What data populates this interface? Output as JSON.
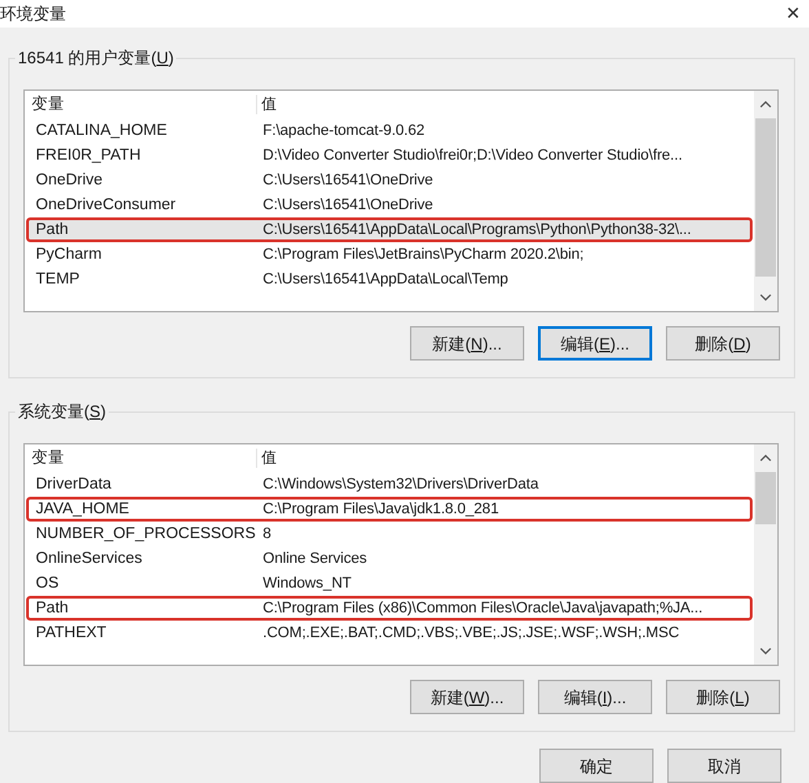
{
  "window": {
    "title": "环境变量",
    "close": "✕"
  },
  "groups": [
    {
      "label": "16541 的用户变量(",
      "accel": "U",
      "label_end": ")",
      "columns": [
        "变量",
        "值"
      ],
      "rows": [
        {
          "name": "CATALINA_HOME",
          "value": "F:\\apache-tomcat-9.0.62",
          "selected": false,
          "highlighted": false
        },
        {
          "name": "FREI0R_PATH",
          "value": "D:\\Video Converter Studio\\frei0r;D:\\Video Converter Studio\\fre...",
          "selected": false,
          "highlighted": false
        },
        {
          "name": "OneDrive",
          "value": "C:\\Users\\16541\\OneDrive",
          "selected": false,
          "highlighted": false
        },
        {
          "name": "OneDriveConsumer",
          "value": "C:\\Users\\16541\\OneDrive",
          "selected": false,
          "highlighted": false
        },
        {
          "name": "Path",
          "value": "C:\\Users\\16541\\AppData\\Local\\Programs\\Python\\Python38-32\\...",
          "selected": true,
          "highlighted": true
        },
        {
          "name": "PyCharm",
          "value": "C:\\Program Files\\JetBrains\\PyCharm 2020.2\\bin;",
          "selected": false,
          "highlighted": false
        },
        {
          "name": "TEMP",
          "value": "C:\\Users\\16541\\AppData\\Local\\Temp",
          "selected": false,
          "highlighted": false
        }
      ],
      "buttons": [
        {
          "label": "新建(",
          "accel": "N",
          "tail": ")...",
          "default": false
        },
        {
          "label": "编辑(",
          "accel": "E",
          "tail": ")...",
          "default": true
        },
        {
          "label": "删除(",
          "accel": "D",
          "tail": ")",
          "default": false
        }
      ]
    },
    {
      "label": "系统变量(",
      "accel": "S",
      "label_end": ")",
      "columns": [
        "变量",
        "值"
      ],
      "rows": [
        {
          "name": "DriverData",
          "value": "C:\\Windows\\System32\\Drivers\\DriverData",
          "selected": false,
          "highlighted": false
        },
        {
          "name": "JAVA_HOME",
          "value": "C:\\Program Files\\Java\\jdk1.8.0_281",
          "selected": false,
          "highlighted": true
        },
        {
          "name": "NUMBER_OF_PROCESSORS",
          "value": "8",
          "selected": false,
          "highlighted": false
        },
        {
          "name": "OnlineServices",
          "value": "Online Services",
          "selected": false,
          "highlighted": false
        },
        {
          "name": "OS",
          "value": "Windows_NT",
          "selected": false,
          "highlighted": false
        },
        {
          "name": "Path",
          "value": "C:\\Program Files (x86)\\Common Files\\Oracle\\Java\\javapath;%JA...",
          "selected": false,
          "highlighted": true
        },
        {
          "name": "PATHEXT",
          "value": ".COM;.EXE;.BAT;.CMD;.VBS;.VBE;.JS;.JSE;.WSF;.WSH;.MSC",
          "selected": false,
          "highlighted": false
        }
      ],
      "buttons": [
        {
          "label": "新建(",
          "accel": "W",
          "tail": ")...",
          "default": false
        },
        {
          "label": "编辑(",
          "accel": "I",
          "tail": ")...",
          "default": false
        },
        {
          "label": "删除(",
          "accel": "L",
          "tail": ")",
          "default": false
        }
      ]
    }
  ],
  "footer_buttons": [
    "确定",
    "取消"
  ]
}
